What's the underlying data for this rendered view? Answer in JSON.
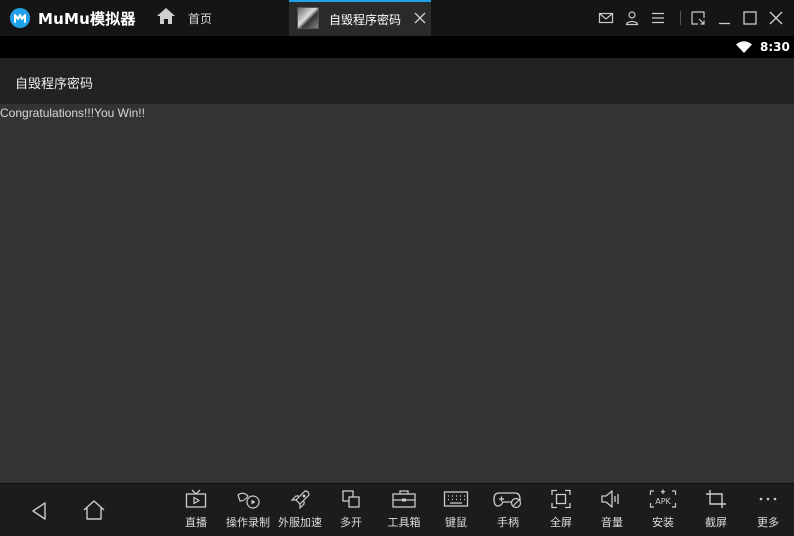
{
  "titlebar": {
    "app_name": "MuMu模拟器",
    "home_tab": "首页",
    "active_tab": "自毁程序密码",
    "window_controls": [
      "mail-icon",
      "user-icon",
      "menu-icon",
      "restore-small-icon",
      "minimize-icon",
      "maximize-icon",
      "close-icon"
    ]
  },
  "statusbar": {
    "time": "8:30",
    "icons": [
      "wifi-icon"
    ]
  },
  "appbar": {
    "title": "自毁程序密码"
  },
  "content": {
    "message": "Congratulations!!!You Win!!"
  },
  "toolbar": {
    "nav": [
      "back-icon",
      "home-icon"
    ],
    "tools": [
      {
        "label": "直播",
        "icon": "live-icon"
      },
      {
        "label": "操作录制",
        "icon": "record-icon"
      },
      {
        "label": "外服加速",
        "icon": "rocket-icon"
      },
      {
        "label": "多开",
        "icon": "multi-open-icon"
      },
      {
        "label": "工具箱",
        "icon": "toolbox-icon"
      },
      {
        "label": "键鼠",
        "icon": "keyboard-icon"
      },
      {
        "label": "手柄",
        "icon": "gamepad-icon"
      },
      {
        "label": "全屏",
        "icon": "fullscreen-icon"
      },
      {
        "label": "音量",
        "icon": "volume-icon"
      },
      {
        "label": "安装",
        "icon": "apk-icon"
      },
      {
        "label": "截屏",
        "icon": "crop-icon"
      },
      {
        "label": "更多",
        "icon": "more-icon"
      }
    ]
  },
  "colors": {
    "accent": "#1fa2ea",
    "content_bg": "#333333",
    "toolbar_bg": "#1c1c1c"
  }
}
